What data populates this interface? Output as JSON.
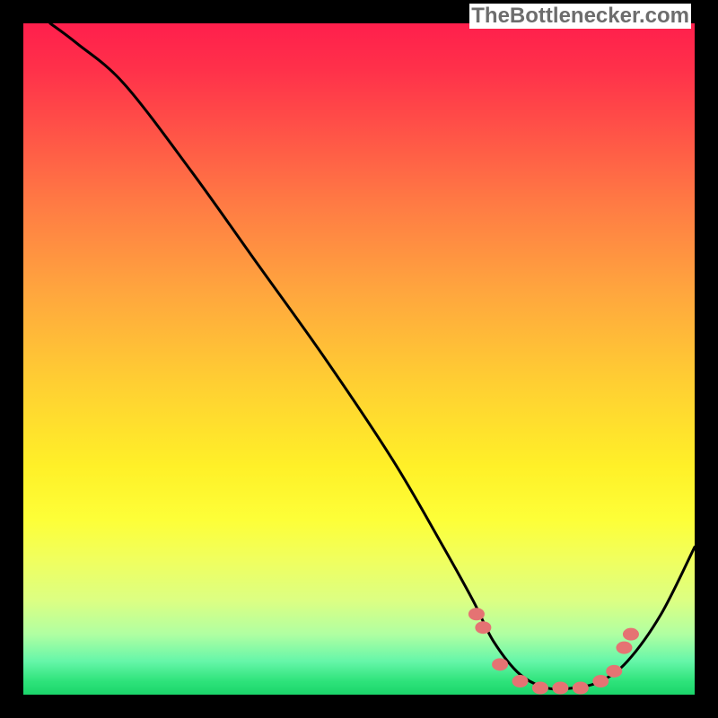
{
  "attribution": "TheBottlenecker.com",
  "chart_data": {
    "type": "line",
    "title": "",
    "xlabel": "",
    "ylabel": "",
    "xlim": [
      0,
      100
    ],
    "ylim": [
      0,
      100
    ],
    "series": [
      {
        "name": "curve",
        "x": [
          4,
          8,
          15,
          25,
          35,
          45,
          55,
          62,
          67,
          70,
          74,
          78,
          82,
          86,
          90,
          95,
          100
        ],
        "y": [
          100,
          97,
          91,
          78,
          64,
          50,
          35,
          23,
          14,
          8,
          3,
          1,
          1,
          2,
          5,
          12,
          22
        ]
      }
    ],
    "markers": {
      "name": "highlight-points",
      "x": [
        67.5,
        68.5,
        71,
        74,
        77,
        80,
        83,
        86,
        88,
        89.5,
        90.5
      ],
      "y": [
        12,
        10,
        4.5,
        2,
        1,
        1,
        1,
        2,
        3.5,
        7,
        9
      ]
    },
    "marker_color": "#e57373",
    "curve_color": "#000000"
  }
}
